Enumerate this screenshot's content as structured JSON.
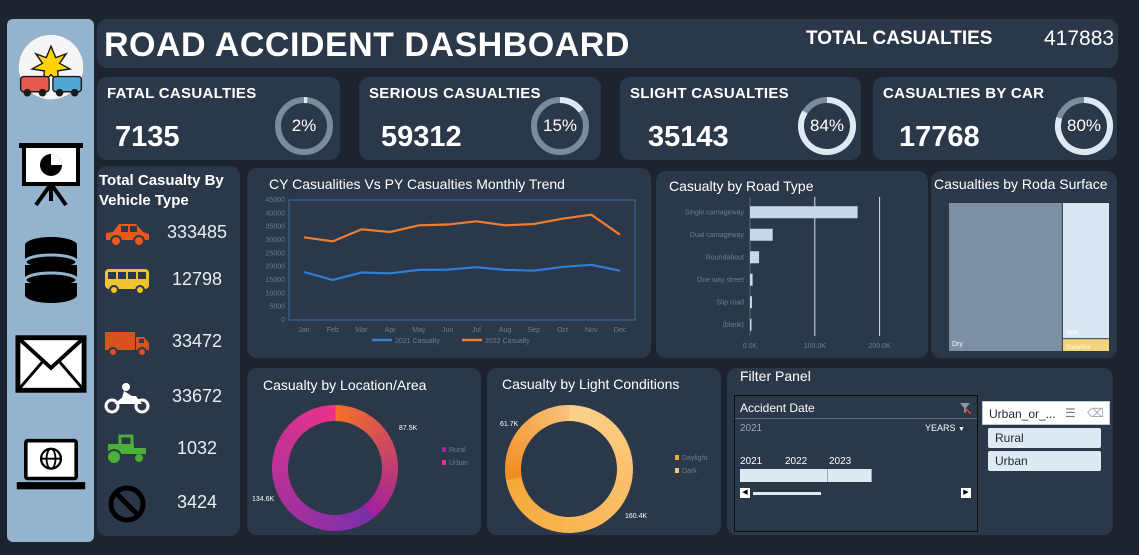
{
  "header": {
    "title": "ROAD ACCIDENT DASHBOARD",
    "total_label": "TOTAL CASUALTIES",
    "total_value": "417883"
  },
  "sidebar": {
    "items": [
      {
        "icon": "car-crash-logo-icon"
      },
      {
        "icon": "presentation-icon"
      },
      {
        "icon": "database-icon"
      },
      {
        "icon": "mail-icon"
      },
      {
        "icon": "laptop-globe-icon"
      }
    ]
  },
  "kpis": [
    {
      "label": "FATAL CASUALTIES",
      "value": "7135",
      "pct_label": "2%",
      "pct": 2
    },
    {
      "label": "SERIOUS CASUALTIES",
      "value": "59312",
      "pct_label": "15%",
      "pct": 15
    },
    {
      "label": "SLIGHT CASUALTIES",
      "value": "35143",
      "pct_label": "84%",
      "pct": 84
    },
    {
      "label": "CASUALTIES BY CAR",
      "value": "17768",
      "pct_label": "80%",
      "pct": 80
    }
  ],
  "vehicle": {
    "title": "Total Casualty By Vehicle Type",
    "items": [
      {
        "icon": "car-icon",
        "value": "333485"
      },
      {
        "icon": "bus-icon",
        "value": "12798"
      },
      {
        "icon": "truck-icon",
        "value": "33472"
      },
      {
        "icon": "motorcycle-icon",
        "value": "33672"
      },
      {
        "icon": "tractor-icon",
        "value": "1032"
      },
      {
        "icon": "no-entry-icon",
        "value": "3424"
      }
    ]
  },
  "colors": {
    "accent_blue": "#2f7ed8",
    "accent_orange": "#ed7d31",
    "panel": "#2b3849",
    "sidebar": "#93b3cf"
  },
  "chart_data": [
    {
      "type": "line",
      "title": "CY Casualities Vs PY Casualties Monthly Trend",
      "categories": [
        "Jan",
        "Feb",
        "Mar",
        "Apr",
        "May",
        "Jun",
        "Jul",
        "Aug",
        "Sep",
        "Oct",
        "Nov",
        "Dec"
      ],
      "series": [
        {
          "name": "2021 Casualty",
          "color": "#2f7ed8",
          "values": [
            18000,
            15000,
            17800,
            17500,
            18800,
            18900,
            19800,
            18800,
            18500,
            19900,
            20700,
            18500
          ]
        },
        {
          "name": "2022 Casualty",
          "color": "#ed7d31",
          "values": [
            31000,
            29500,
            34000,
            33000,
            35500,
            35800,
            37000,
            35500,
            36000,
            38000,
            39500,
            32000
          ]
        }
      ],
      "ylim": [
        0,
        45000
      ],
      "yticks": [
        "0",
        "5000",
        "10000",
        "15000",
        "20000",
        "25000",
        "30000",
        "35000",
        "40000",
        "45000"
      ],
      "legend": "bottom"
    },
    {
      "type": "bar",
      "orientation": "horizontal",
      "title": "Casualty by Road Type",
      "categories": [
        "Single carriageway",
        "Dual carriageway",
        "Roundabout",
        "One way street",
        "Slip road",
        "(blank)"
      ],
      "values": [
        166000,
        35000,
        14000,
        4000,
        3000,
        1000
      ],
      "xlim": [
        0,
        250000
      ],
      "xticks": [
        "0.0K",
        "100.0K",
        "200.0K"
      ]
    },
    {
      "type": "treemap",
      "title": "Casualties by Roda Surface",
      "categories": [
        "Dry",
        "Wet",
        "Snow/Ice"
      ],
      "values": [
        279000,
        104000,
        9000
      ]
    },
    {
      "type": "pie",
      "donut": true,
      "title": "Casualty by Location/Area",
      "categories": [
        "Rural",
        "Urban"
      ],
      "values": [
        87.5,
        134.6
      ],
      "value_labels": [
        "87.5K",
        "134.6K"
      ],
      "legend": "right"
    },
    {
      "type": "pie",
      "donut": true,
      "title": "Casualty by Light Conditions",
      "categories": [
        "Daylight",
        "Dark"
      ],
      "values": [
        160.4,
        61.7
      ],
      "value_labels": [
        "160.4K",
        "61.7K"
      ],
      "legend": "right"
    }
  ],
  "filter": {
    "title": "Filter Panel",
    "date_slicer": {
      "title": "Accident Date",
      "selected": "2021",
      "granularity": "YEARS",
      "years": [
        "2021",
        "2022",
        "2023"
      ]
    },
    "area_slicer": {
      "title": "Urban_or_...",
      "options": [
        "Rural",
        "Urban"
      ]
    }
  }
}
